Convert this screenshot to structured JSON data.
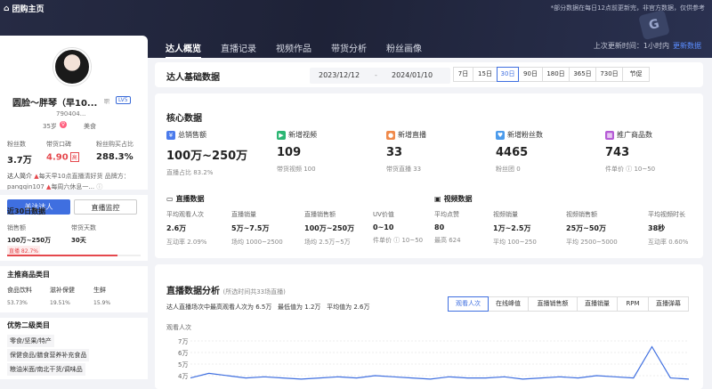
{
  "topbar": {
    "home": "团购主页",
    "notice": "*部分数据在每日12点前更新完，非官方数据，仅供参考",
    "tabs": [
      {
        "label": "达人概览",
        "active": true
      },
      {
        "label": "直播记录",
        "active": false
      },
      {
        "label": "视频作品",
        "active": false
      },
      {
        "label": "带货分析",
        "active": false
      },
      {
        "label": "粉丝画像",
        "active": false
      }
    ],
    "update_label": "上次更新时间：1小时内",
    "update_link": "更新数据",
    "badge": "G"
  },
  "profile": {
    "name": "圆脸～胖琴（早10...",
    "badge1": "职",
    "level": "LV5",
    "id": "790404...",
    "age": "35岁",
    "gender_symbol": "♀",
    "category": "美食",
    "stats": [
      {
        "label": "粉丝数",
        "value": "3.7万"
      },
      {
        "label": "带货口碑",
        "value": "4.90",
        "tag": "高"
      },
      {
        "label": "粉丝购买占比",
        "value": "288.3%"
      }
    ],
    "intro_label": "达人简介",
    "intro_text": "每天早10点直播清好货",
    "brand_label": "品牌方：",
    "brand_id": "pangqin107",
    "intro_text2": "每周六休息一...",
    "follow_button": "关注达人",
    "monitor_button": "直播监控"
  },
  "recent30": {
    "title": "近30日数据",
    "sales_label": "销售额",
    "sales_value": "100万~250万",
    "days_label": "带货天数",
    "days_value": "30天",
    "live_share_label": "直播 82.7%",
    "live_share": 0.827
  },
  "main_categories": {
    "title": "主推商品类目",
    "items": [
      {
        "name": "食品饮料",
        "pct": "53.73%"
      },
      {
        "name": "滋补保健",
        "pct": "19.51%"
      },
      {
        "name": "生鲜",
        "pct": "15.9%"
      }
    ]
  },
  "secondary": {
    "title": "优势二级类目",
    "chips": [
      "零食/坚果/特产",
      "保健食品/膳食营养补充食品",
      "粮油米面/南北干货/调味品"
    ]
  },
  "basic": {
    "title": "达人基础数据",
    "date_start": "2023/12/12",
    "date_sep": "-",
    "date_end": "2024/01/10",
    "ranges": [
      {
        "label": "7日",
        "active": false
      },
      {
        "label": "15日",
        "active": false
      },
      {
        "label": "30日",
        "active": true
      },
      {
        "label": "90日",
        "active": false
      },
      {
        "label": "180日",
        "active": false
      },
      {
        "label": "365日",
        "active": false
      },
      {
        "label": "730日",
        "active": false
      },
      {
        "label": "节促",
        "active": false
      }
    ]
  },
  "core": {
    "title": "核心数据",
    "metrics": [
      {
        "label": "总销售额",
        "value": "100万~250万",
        "sub": "直播占比 83.2%",
        "color": "#4b7bec"
      },
      {
        "label": "新增视频",
        "value": "109",
        "sub": "带货视频 100",
        "color": "#2bb673"
      },
      {
        "label": "新增直播",
        "value": "33",
        "sub": "带货直播 33",
        "color": "#f08a4b"
      },
      {
        "label": "新增粉丝数",
        "value": "4465",
        "sub": "粉丝团 0",
        "color": "#4b9bec"
      },
      {
        "label": "推广商品数",
        "value": "743",
        "sub": "件单价 ⓘ 10~50",
        "color": "#b65bd6"
      }
    ],
    "live_title": "直播数据",
    "video_title": "视频数据",
    "live": [
      {
        "k": "平均观看人次",
        "v": "2.6万",
        "s": "互动率 2.09%"
      },
      {
        "k": "直播销量",
        "v": "5万~7.5万",
        "s": "场均 1000~2500"
      },
      {
        "k": "直播销售额",
        "v": "100万~250万",
        "s": "场均 2.5万~5万"
      },
      {
        "k": "UV价值",
        "v": "0~10",
        "s": "件单价 ⓘ 10~50"
      }
    ],
    "video": [
      {
        "k": "平均点赞",
        "v": "80",
        "s": "最高 624"
      },
      {
        "k": "视频销量",
        "v": "1万~2.5万",
        "s": "平均 100~250"
      },
      {
        "k": "视频销售额",
        "v": "25万~50万",
        "s": "平均 2500~5000"
      },
      {
        "k": "平均视频时长",
        "v": "38秒",
        "s": "互动率 0.60%"
      }
    ]
  },
  "analysis": {
    "title": "直播数据分析",
    "subtitle": "(所选时间共33场直播)",
    "summary": "达人直播场次中最高观看人次为 6.5万",
    "min_label": "最低值为 1.2万",
    "avg_label": "平均值为 2.6万",
    "buttons": [
      {
        "label": "观看人次",
        "active": true
      },
      {
        "label": "在线峰值",
        "active": false
      },
      {
        "label": "直播销售额",
        "active": false
      },
      {
        "label": "直播销量",
        "active": false
      },
      {
        "label": "RPM",
        "active": false
      },
      {
        "label": "直播弹幕",
        "active": false
      }
    ],
    "chart_data": {
      "type": "line",
      "title": "",
      "ylabel": "观看人次",
      "y_ticks": [
        "7万",
        "6万",
        "5万",
        "4万"
      ],
      "ylim": [
        40000,
        70000
      ],
      "visible_values": [
        38000,
        42000,
        40000,
        38000,
        39000,
        38000,
        37000,
        38000,
        39000,
        38000,
        40000,
        39000,
        38000,
        37000,
        39000,
        38000,
        38000,
        39000,
        37000,
        38000,
        39000,
        38000,
        40000,
        39000,
        38000,
        65000,
        38000,
        37000
      ]
    }
  }
}
